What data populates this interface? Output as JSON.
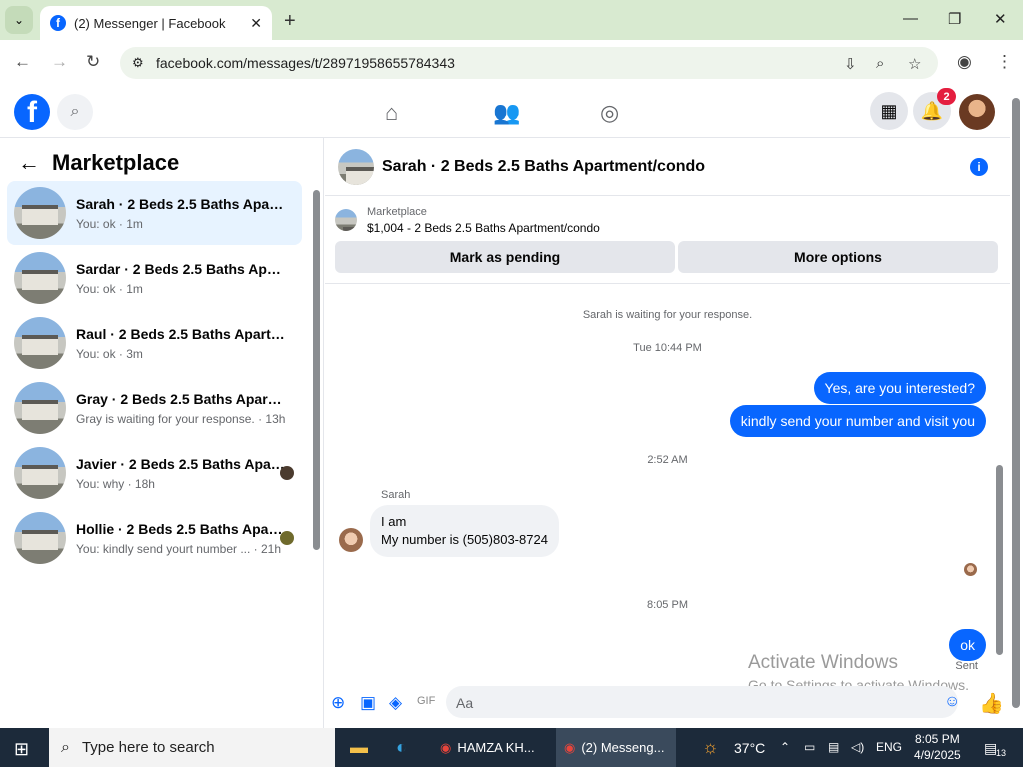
{
  "browser": {
    "tab_title": "(2) Messenger | Facebook",
    "tab_favicon": "f",
    "url": "facebook.com/messages/t/28971958655784343"
  },
  "fb": {
    "notifications_badge": "2"
  },
  "sidebar": {
    "title": "Marketplace",
    "conversations": [
      {
        "title": "Sarah · 2 Beds 2.5 Baths Apartment/condo",
        "subtitle": "You: ok · 1m",
        "active": true
      },
      {
        "title": "Sardar · 2 Beds 2.5 Baths Apartment/condo",
        "subtitle": "You: ok · 1m"
      },
      {
        "title": "Raul · 2 Beds 2.5 Baths Apartment/condo",
        "subtitle": "You: ok · 3m"
      },
      {
        "title": "Gray · 2 Beds 2.5 Baths Apartment/condo",
        "subtitle": "Gray is waiting for your response. · 13h"
      },
      {
        "title": "Javier · 2 Beds 2.5 Baths Apartment/condo",
        "subtitle": "You: why · 18h"
      },
      {
        "title": "Hollie · 2 Beds 2.5 Baths Apartment/condo",
        "subtitle": "You: kindly send yourt number ... · 21h"
      }
    ]
  },
  "chat": {
    "title": "Sarah · 2 Beds 2.5 Baths Apartment/condo",
    "marketplace_label": "Marketplace",
    "listing": "$1,004 - 2 Beds 2.5 Baths Apartment/condo",
    "mark_pending": "Mark as pending",
    "more_options": "More options",
    "waiting": "Sarah is waiting for your response.",
    "time1": "Tue 10:44 PM",
    "out1": "Yes, are you interested?",
    "out2": "kindly send your number and visit you",
    "time2": "2:52 AM",
    "sender": "Sarah",
    "in1_line1": "I am",
    "in1_line2": "My number is (505)803-8724",
    "time3": "8:05 PM",
    "out3": "ok",
    "sent": "Sent",
    "composer_placeholder": "Aa"
  },
  "watermark": {
    "line1": "Activate Windows",
    "line2": "Go to Settings to activate Windows."
  },
  "taskbar": {
    "search": "Type here to search",
    "app1": "HAMZA KH...",
    "app2": "(2) Messeng...",
    "weather": "37°C",
    "lang": "ENG",
    "time": "8:05 PM",
    "date": "4/9/2025",
    "notif_count": "13"
  }
}
